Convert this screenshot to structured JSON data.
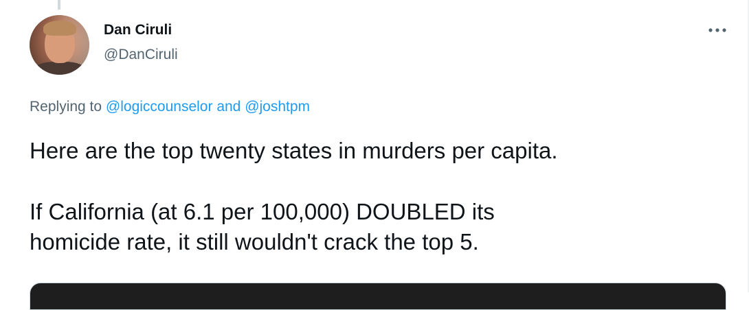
{
  "tweet": {
    "author_name": "Dan Ciruli",
    "author_handle": "@DanCiruli",
    "replying_prefix": "Replying to",
    "reply_mention_1": "@logiccounselor",
    "reply_connector": "and",
    "reply_mention_2": "@joshtpm",
    "text_line_1": "Here are the top twenty states in murders per capita.",
    "text_line_2": "If California (at 6.1 per 100,000) DOUBLED its",
    "text_line_3": "homicide rate, it still wouldn't crack the top 5."
  },
  "icons": {
    "more": "more-options-icon",
    "avatar": "avatar"
  },
  "colors": {
    "text_primary": "#0f1419",
    "text_secondary": "#536471",
    "link": "#1d9bf0"
  }
}
